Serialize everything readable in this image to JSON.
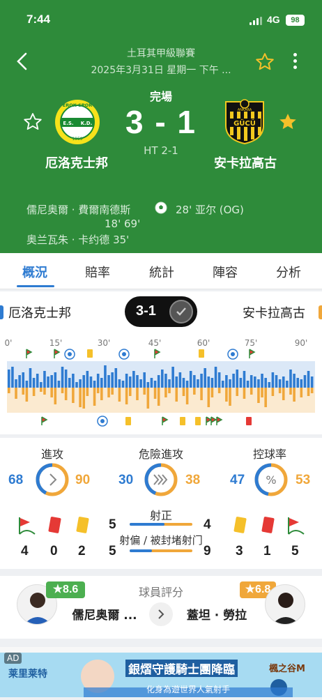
{
  "status_bar": {
    "time": "7:44",
    "network": "4G",
    "battery": "98"
  },
  "header": {
    "league": "土耳其甲級聯賽",
    "date": "2025年3月31日 星期一 下午 ...",
    "match_status": "完場",
    "score": "3 - 1",
    "half_time": "HT 2-1",
    "home_name": "厄洛克士邦",
    "away_name": "安卡拉高古",
    "home_logo_text": [
      "EROK·SPOR",
      "E.S.",
      "K.D.",
      "1959"
    ],
    "away_logo_text": [
      "ANKARA",
      "GÜCÜ"
    ],
    "scorers_home_1": "儒尼奥爾 · 費爾南德斯",
    "scorers_home_2": "18' 69'",
    "scorers_home_3": "奥兰瓦朱 · 卡约德 35'",
    "scorers_away": "28' 亚尔 (OG)"
  },
  "tabs": [
    "概況",
    "賠率",
    "統計",
    "陣容",
    "分析"
  ],
  "summary": {
    "home": "厄洛克士邦",
    "away": "安卡拉高古",
    "score": "3-1"
  },
  "timeline": {
    "ticks": [
      "0'",
      "15'",
      "30'",
      "45'",
      "60'",
      "75'",
      "90'"
    ],
    "home_pressure": [
      26,
      30,
      12,
      18,
      22,
      10,
      28,
      14,
      20,
      8,
      24,
      16,
      18,
      22,
      10,
      30,
      26,
      14,
      20,
      8,
      12,
      18,
      24,
      16,
      10,
      20,
      14,
      32,
      18,
      22,
      28,
      12,
      10,
      20,
      16,
      24,
      18,
      12,
      22,
      8,
      14,
      10,
      18,
      26,
      20,
      12,
      30,
      16,
      22,
      14,
      10,
      24,
      18,
      12,
      20,
      28,
      16,
      14,
      30,
      22,
      10,
      18,
      12,
      20,
      26,
      14,
      24,
      10,
      18,
      16,
      12,
      20,
      14,
      8,
      22,
      18,
      12,
      16,
      10,
      26,
      20,
      14,
      12,
      18,
      24,
      16
    ],
    "away_pressure": [
      8,
      0,
      16,
      0,
      10,
      20,
      0,
      12,
      0,
      6,
      10,
      0,
      14,
      24,
      0,
      8,
      18,
      0,
      22,
      0,
      28,
      30,
      12,
      0,
      26,
      8,
      18,
      0,
      14,
      10,
      0,
      20,
      0,
      24,
      12,
      0,
      18,
      0,
      10,
      30,
      0,
      16,
      26,
      0,
      14,
      8,
      0,
      20,
      0,
      12,
      24,
      0,
      10,
      0,
      18,
      0,
      28,
      14,
      0,
      8,
      0,
      20,
      26,
      0,
      12,
      0,
      16,
      0,
      10,
      0,
      22,
      14,
      28,
      0,
      12,
      0,
      8,
      18,
      0,
      10,
      20,
      0,
      14,
      0,
      12,
      8
    ]
  },
  "stats": {
    "attack": {
      "label": "進攻",
      "home": "68",
      "away": "90",
      "home_frac": 0.43
    },
    "danger": {
      "label": "危險進攻",
      "home": "30",
      "away": "38",
      "home_frac": 0.44
    },
    "possession": {
      "label": "控球率",
      "home": "47",
      "away": "53",
      "home_frac": 0.47
    },
    "home_corners": "4",
    "home_red": "0",
    "home_yellow": "2",
    "away_yellow": "3",
    "away_red": "1",
    "away_corners": "5",
    "on_target": {
      "label": "射正",
      "home": "5",
      "away": "4",
      "home_frac": 0.56
    },
    "off_target": {
      "label": "射偏 / 被封堵射门",
      "home": "5",
      "away": "9",
      "home_frac": 0.36
    },
    "colors": {
      "home": "#2e7bd1",
      "away": "#f0a73a",
      "red": "#e53935",
      "yellow": "#f5c02a",
      "green": "#2e8b3a"
    }
  },
  "player_rating": {
    "title": "球員評分",
    "home_rating": "★8.6",
    "home_player": "儒尼奥爾 ...",
    "away_rating": "★6.8",
    "away_player": "蓋坦 · 勞拉"
  },
  "ad": {
    "badge": "AD",
    "brand": "莱里莱特",
    "headline": "銀熠守護騎士團降臨",
    "sub": "化身為遊世界人氣射手",
    "game": "楓之谷M"
  }
}
